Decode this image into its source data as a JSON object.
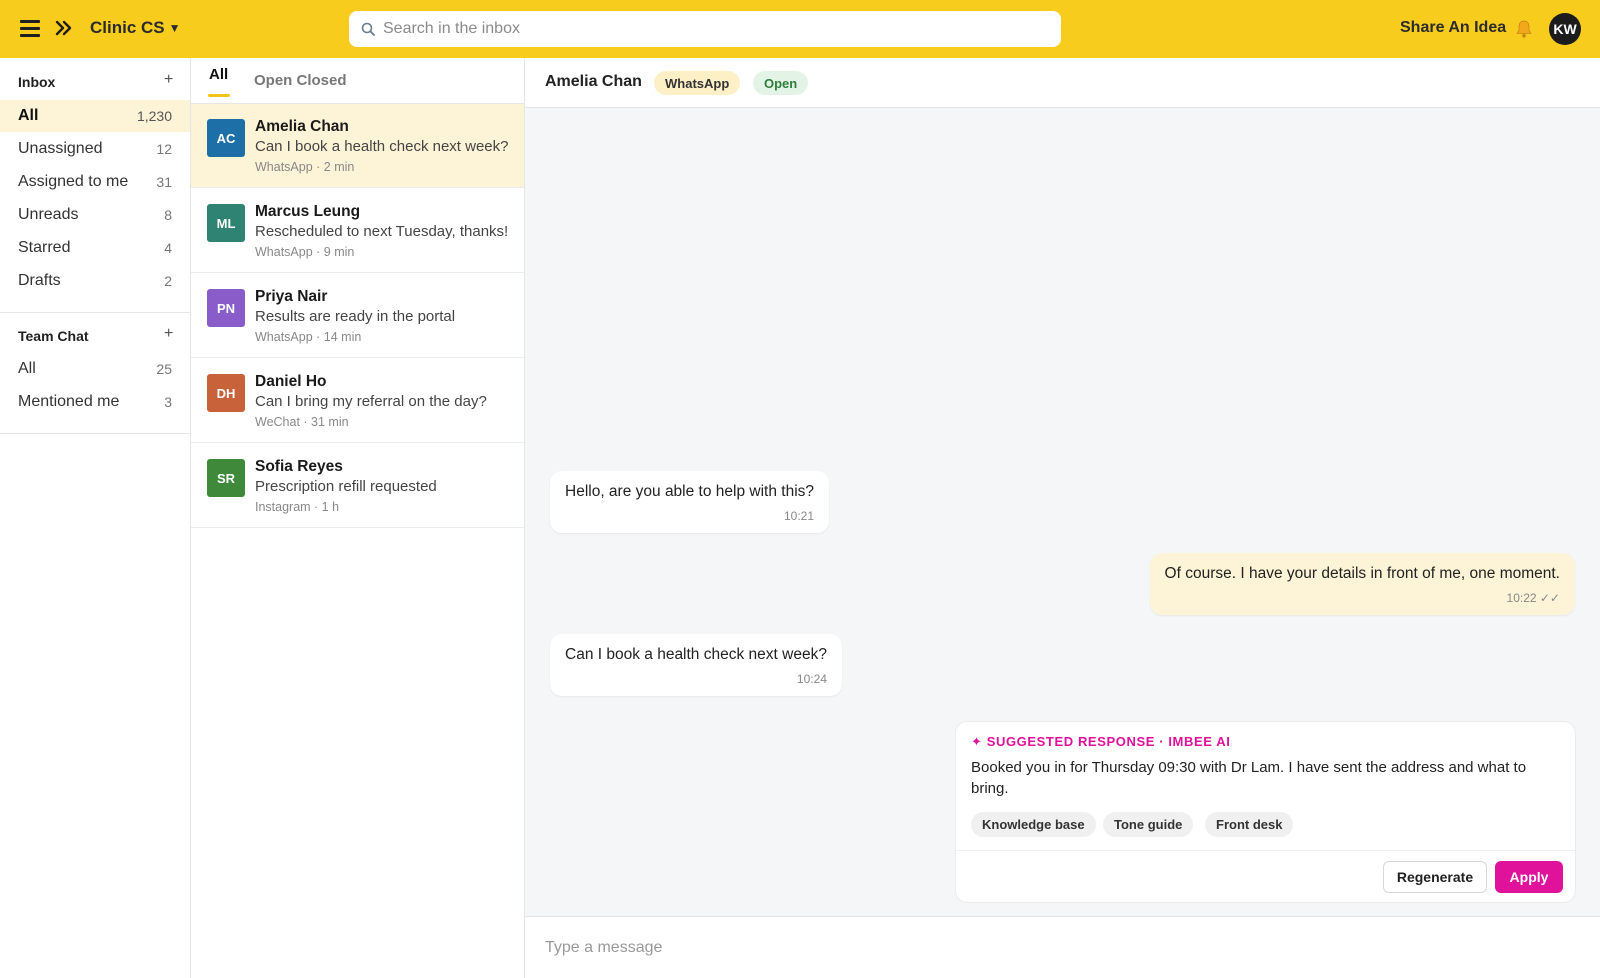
{
  "topbar": {
    "workspace": "Clinic CS",
    "search_placeholder": "Search in the inbox",
    "share_label": "Share An Idea",
    "user_initials": "KW"
  },
  "sidebar": {
    "inbox_title": "Inbox",
    "inbox_add": "+",
    "inbox_items": [
      {
        "label": "All",
        "count": "1,230"
      },
      {
        "label": "Unassigned",
        "count": "12"
      },
      {
        "label": "Assigned to me",
        "count": "31"
      },
      {
        "label": "Unreads",
        "count": "8"
      },
      {
        "label": "Starred",
        "count": "4"
      },
      {
        "label": "Drafts",
        "count": "2"
      }
    ],
    "team_title": "Team Chat",
    "team_add": "+",
    "team_items": [
      {
        "label": "All",
        "count": "25"
      },
      {
        "label": "Mentioned me",
        "count": "3"
      }
    ]
  },
  "list": {
    "tab_all": "All",
    "tab_rest": "Open Closed",
    "conversations": [
      {
        "initials": "AC",
        "color": "#1d6fa8",
        "name": "Amelia Chan",
        "preview": "Can I book a health check next week?",
        "meta": "WhatsApp · 2 min"
      },
      {
        "initials": "ML",
        "color": "#2e8373",
        "name": "Marcus Leung",
        "preview": "Rescheduled to next Tuesday, thanks!",
        "meta": "WhatsApp · 9 min"
      },
      {
        "initials": "PN",
        "color": "#8a5cc9",
        "name": "Priya Nair",
        "preview": "Results are ready in the portal",
        "meta": "WhatsApp · 14 min"
      },
      {
        "initials": "DH",
        "color": "#c8623a",
        "name": "Daniel Ho",
        "preview": "Can I bring my referral on the day?",
        "meta": "WeChat · 31 min"
      },
      {
        "initials": "SR",
        "color": "#3f8a3a",
        "name": "Sofia Reyes",
        "preview": "Prescription refill requested",
        "meta": "Instagram · 1 h"
      }
    ]
  },
  "chat": {
    "contact": "Amelia Chan",
    "channel": "WhatsApp",
    "status": "Open",
    "messages": [
      {
        "text": "Hello, are you able to help with this?",
        "time": "10:21"
      },
      {
        "text": "Of course. I have your details in front of me, one moment.",
        "time": "10:22 ✓✓"
      },
      {
        "text": "Can I book a health check next week?",
        "time": "10:24"
      }
    ],
    "suggestion": {
      "title": "✦ SUGGESTED RESPONSE · IMBEE AI",
      "body": "Booked you in for Thursday 09:30 with Dr Lam. I have sent the address and what to bring.",
      "sources": [
        "Knowledge base",
        "Tone guide",
        "Front desk"
      ],
      "regenerate": "Regenerate",
      "apply": "Apply"
    },
    "composer_placeholder": "Type a message"
  },
  "colors": {
    "brand_yellow": "#f8cc1d",
    "accent_pink": "#e0119a",
    "selected_row": "#fdf3d6"
  }
}
